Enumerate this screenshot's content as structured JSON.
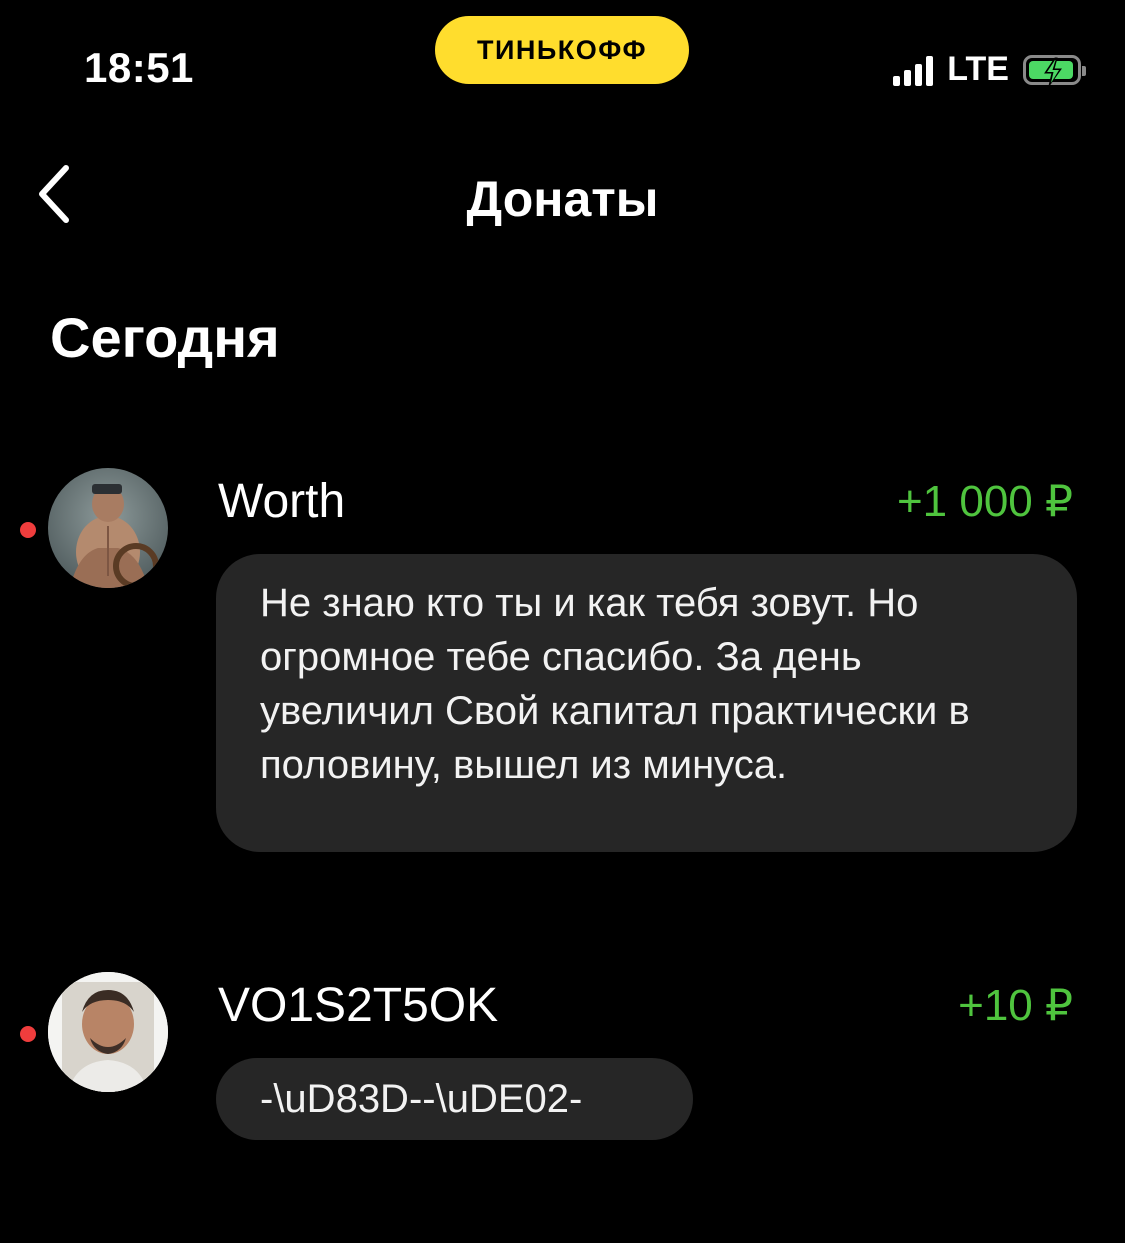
{
  "status_bar": {
    "time": "18:51",
    "carrier_badge": "ТИНЬКОФФ",
    "network": "LTE",
    "signal_icon": "signal-bars-icon",
    "battery_icon": "battery-charging-icon",
    "battery_color": "#4cd964"
  },
  "nav": {
    "back_icon": "chevron-left-icon",
    "title": "Донаты"
  },
  "section": {
    "title": "Сегодня"
  },
  "colors": {
    "background": "#000000",
    "bubble": "#262626",
    "amount_positive": "#4fc43e",
    "unread_dot": "#ef3d3d",
    "brand_yellow": "#ffdd2d"
  },
  "donations": [
    {
      "name": "Worth",
      "amount": "+1 000 ₽",
      "message": "Не знаю кто ты и как тебя зовут. Но огромное тебе спасибо. За день увеличил   Свой капитал практически в половину, вышел из минуса.",
      "unread": true,
      "avatar_icon": "avatar-image"
    },
    {
      "name": "VO1S2T5OK",
      "amount": "+10 ₽",
      "message": "-\\uD83D--\\uDE02-",
      "unread": true,
      "avatar_icon": "avatar-image"
    }
  ]
}
